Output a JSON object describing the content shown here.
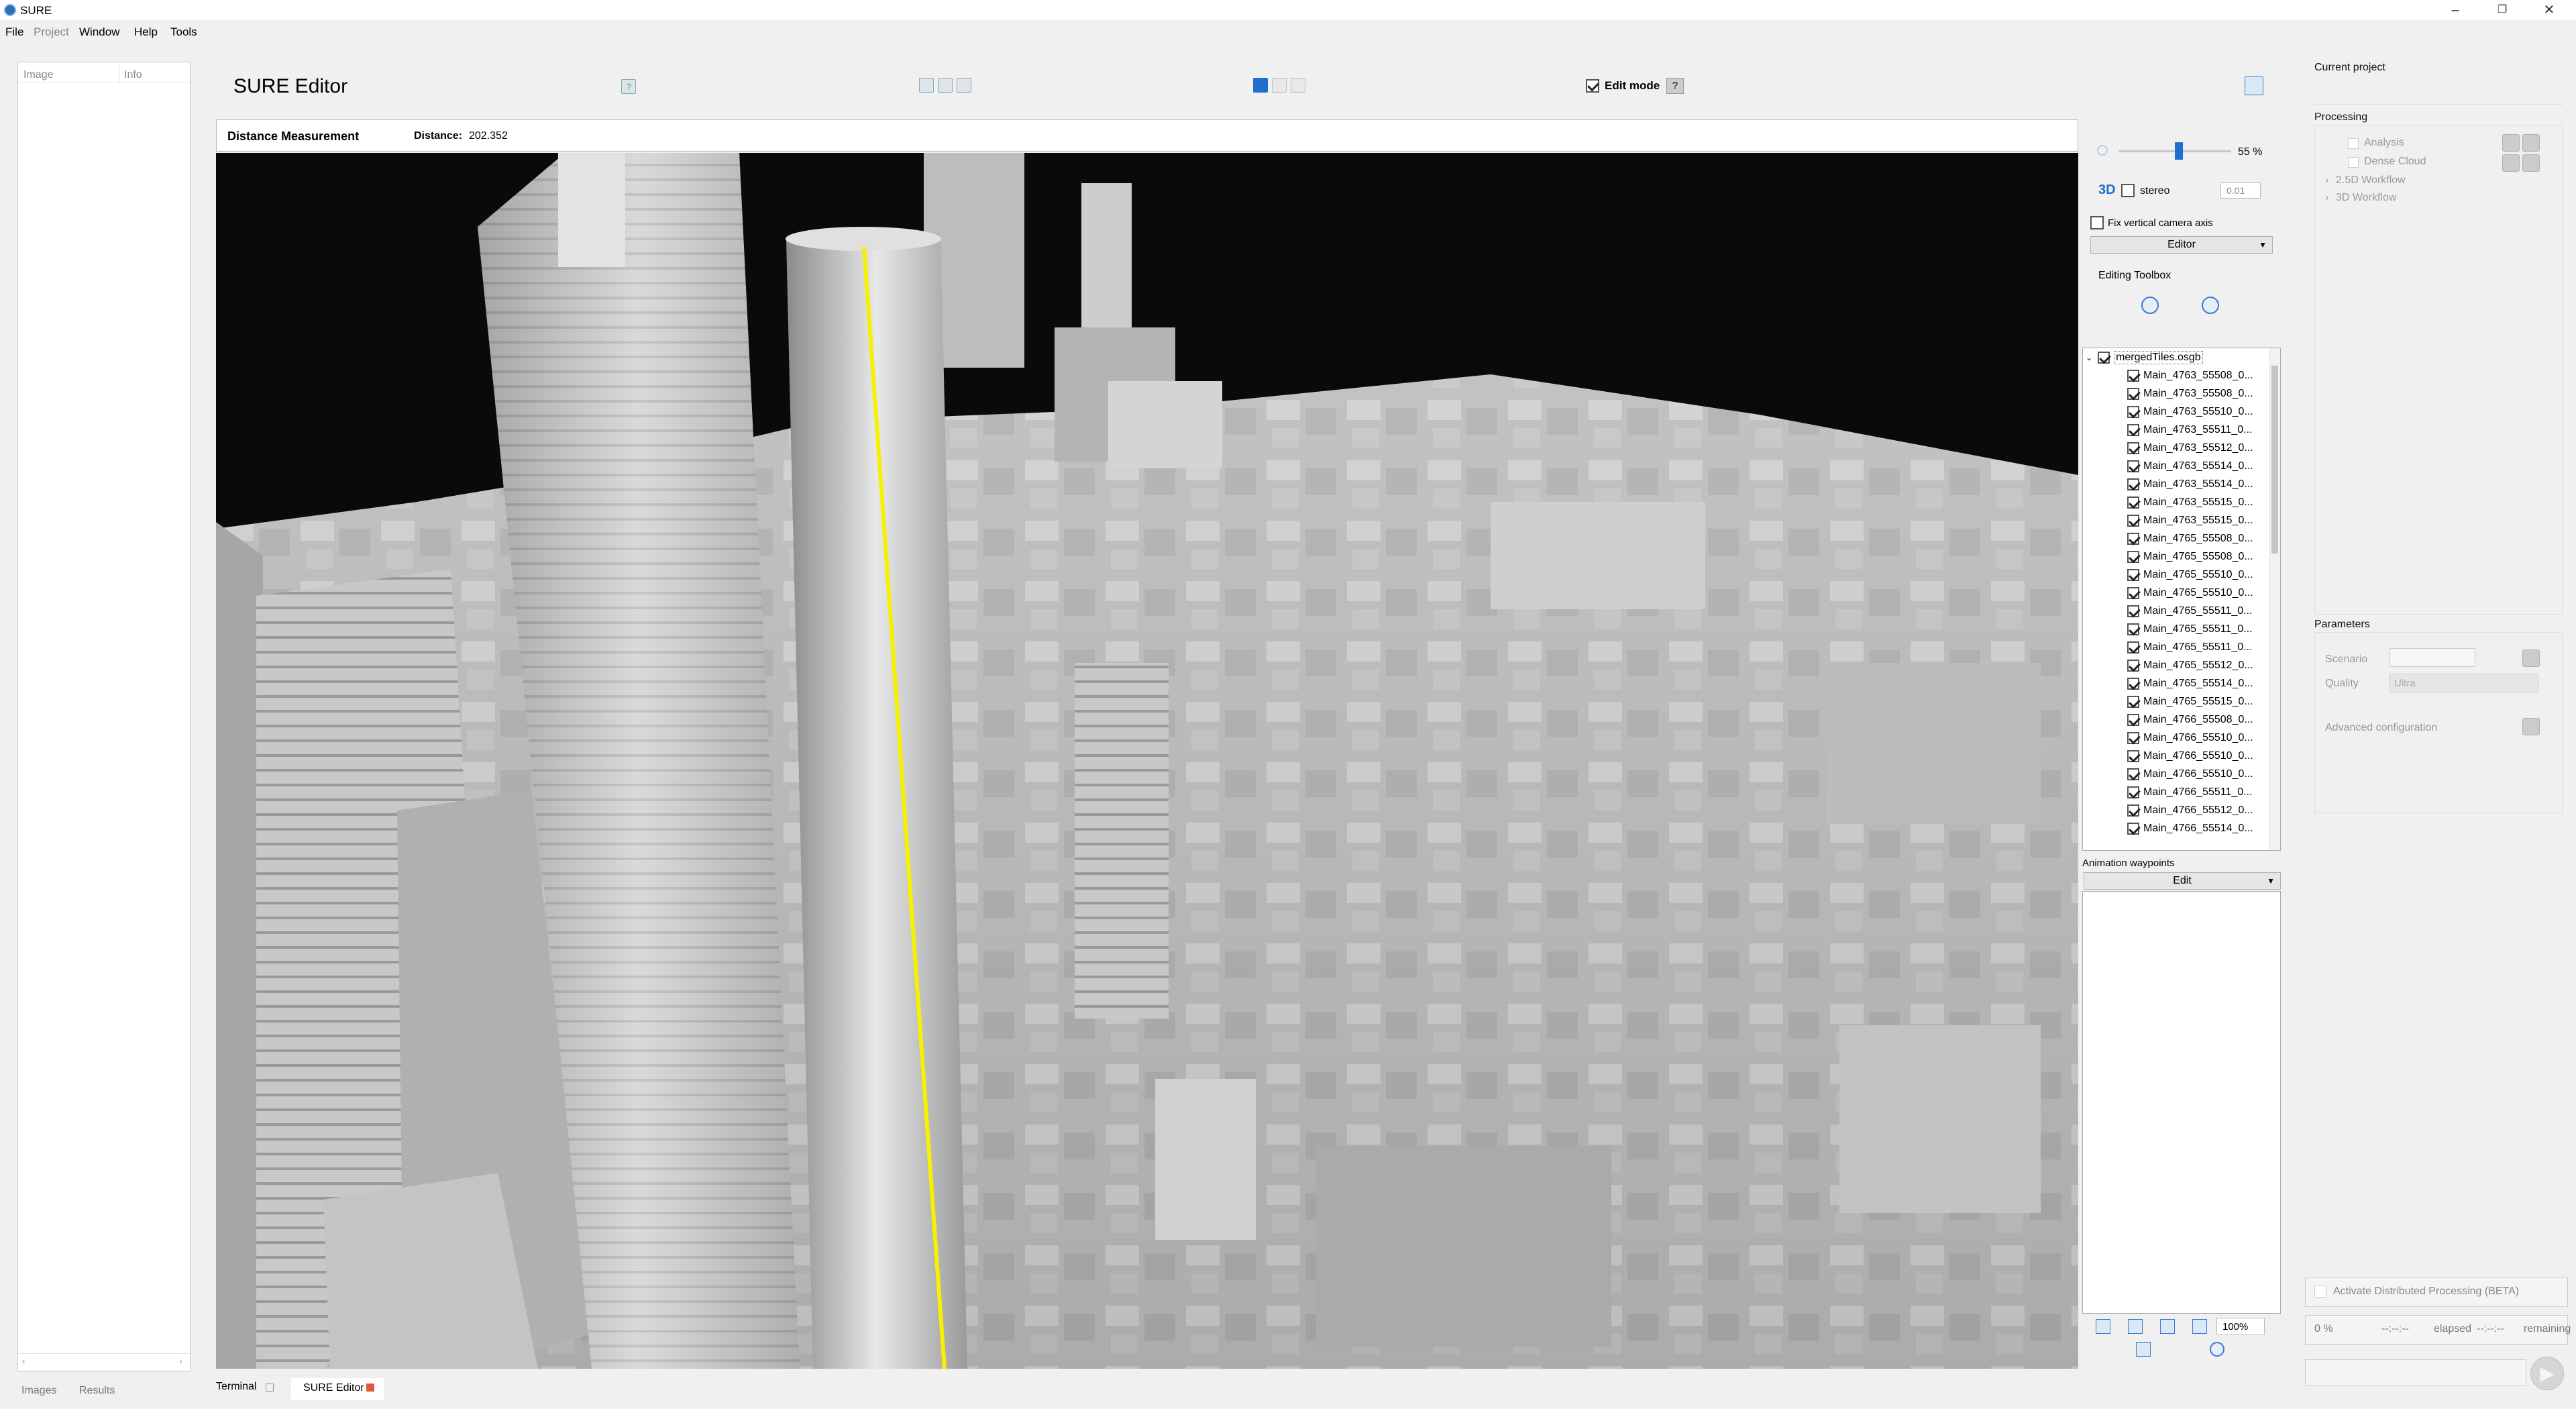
{
  "titlebar": {
    "title": "SURE"
  },
  "menubar": {
    "items": [
      "File",
      "Project",
      "Window",
      "Help",
      "Tools"
    ]
  },
  "left_panel": {
    "columns": {
      "image": "Image",
      "info": "Info"
    },
    "tabs": {
      "images": "Images",
      "results": "Results"
    }
  },
  "editor": {
    "title": "SURE Editor",
    "edit_mode_label": "Edit mode",
    "edit_mode_checked": true,
    "help_label": "?",
    "measurement": {
      "title": "Distance Measurement",
      "distance_label": "Distance:",
      "distance_value": "202.352"
    }
  },
  "view_controls": {
    "opacity_value": "55 %",
    "opacity_fraction": 0.55,
    "label_3d": "3D",
    "stereo_label": "stereo",
    "stereo_value": "0.01",
    "fix_axis_label": "Fix vertical camera axis",
    "mode_select": "Editor",
    "toolbox_label": "Editing Toolbox"
  },
  "tree": {
    "root": "mergedTiles.osgb",
    "items": [
      "Main_4763_55508_0...",
      "Main_4763_55508_0...",
      "Main_4763_55510_0...",
      "Main_4763_55511_0...",
      "Main_4763_55512_0...",
      "Main_4763_55514_0...",
      "Main_4763_55514_0...",
      "Main_4763_55515_0...",
      "Main_4763_55515_0...",
      "Main_4765_55508_0...",
      "Main_4765_55508_0...",
      "Main_4765_55510_0...",
      "Main_4765_55510_0...",
      "Main_4765_55511_0...",
      "Main_4765_55511_0...",
      "Main_4765_55511_0...",
      "Main_4765_55512_0...",
      "Main_4765_55514_0...",
      "Main_4765_55515_0...",
      "Main_4766_55508_0...",
      "Main_4766_55510_0...",
      "Main_4766_55510_0...",
      "Main_4766_55510_0...",
      "Main_4766_55511_0...",
      "Main_4766_55512_0...",
      "Main_4766_55514_0..."
    ]
  },
  "animation": {
    "title": "Animation waypoints",
    "edit_select": "Edit",
    "zoom_value": "100%"
  },
  "right_panel": {
    "current_project": "Current project",
    "processing": "Processing",
    "analysis": "Analysis",
    "dense_cloud": "Dense Cloud",
    "workflow_25d": "2.5D Workflow",
    "workflow_3d": "3D Workflow",
    "parameters": "Parameters",
    "scenario": "Scenario",
    "quality": "Quality",
    "quality_value": "Ultra",
    "advanced": "Advanced configuration",
    "distributed": "Activate Distributed Processing (BETA)",
    "progress_pct": "0 %",
    "elapsed_time": "--:--:--",
    "elapsed": "elapsed",
    "remaining_time": "--:--:--",
    "remaining": "remaining"
  },
  "bottom_tabs": {
    "terminal": "Terminal",
    "sure_editor": "SURE Editor"
  },
  "colors": {
    "accent": "#1f6fd0",
    "measure_line": "#f7f000",
    "viewport_bg": "#0a0a0a"
  }
}
